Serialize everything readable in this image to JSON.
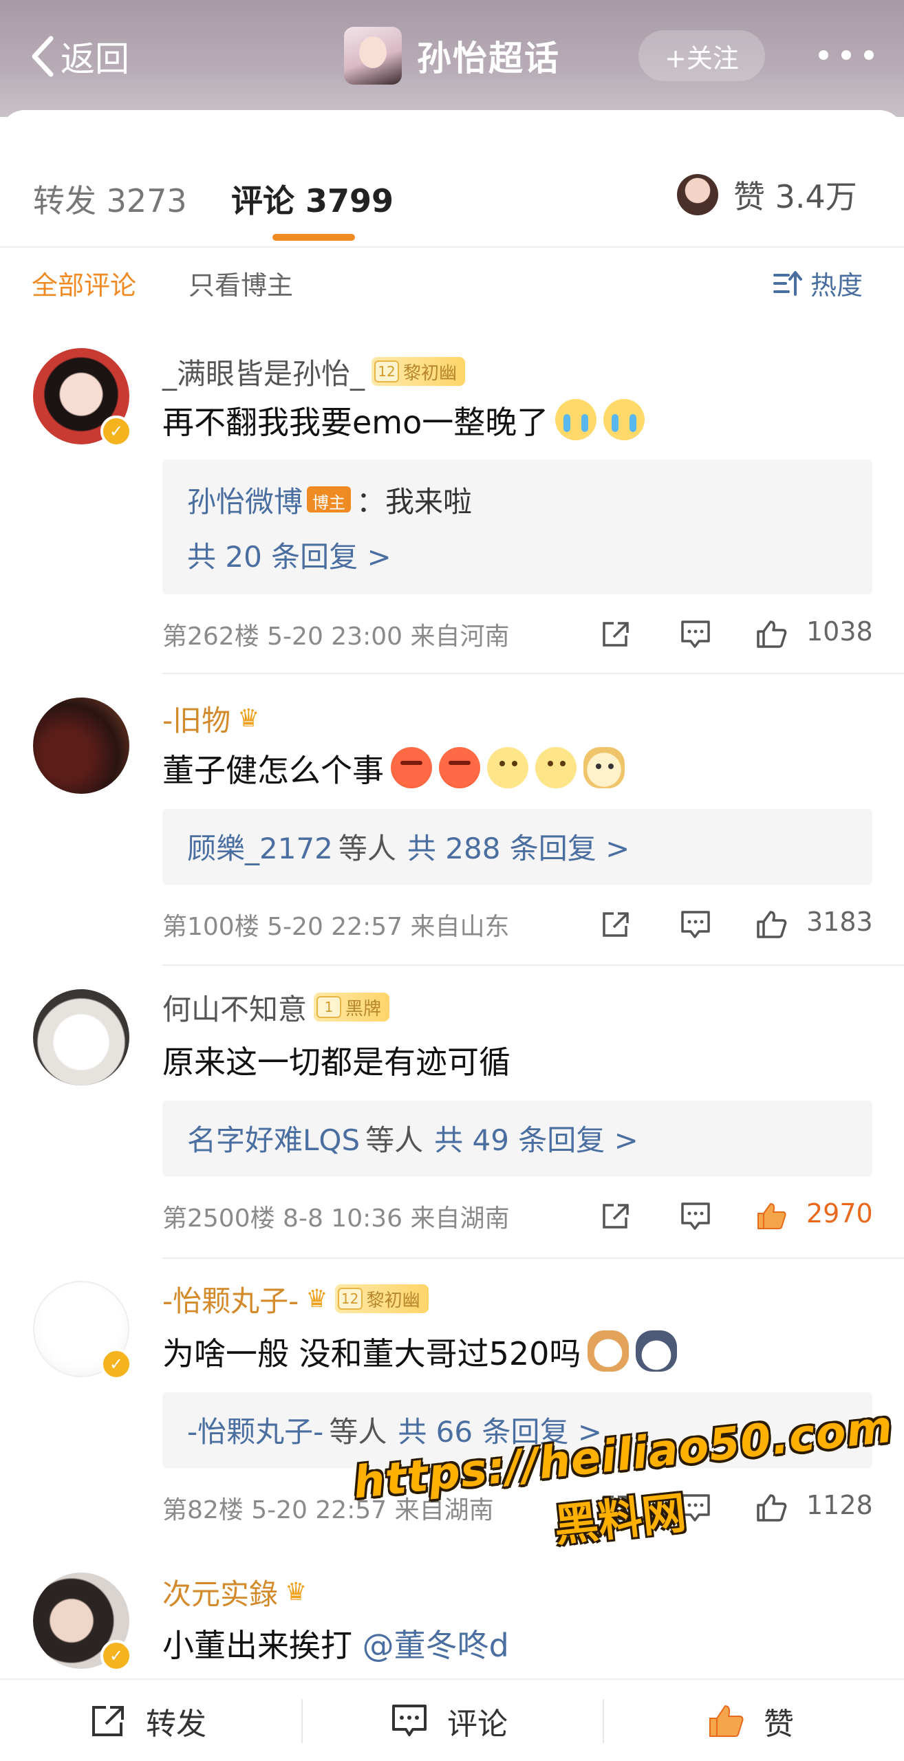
{
  "header": {
    "back_label": "返回",
    "title": "孙怡超话",
    "follow_label": "+关注"
  },
  "tabs": {
    "repost": "转发 3273",
    "comment": "评论 3799",
    "like": "赞 3.4万"
  },
  "filter": {
    "all": "全部评论",
    "owner_only": "只看博主",
    "sort": "热度"
  },
  "comments": [
    {
      "username": "_满眼皆是孙怡_",
      "badge_level": "12",
      "badge_text": "黎初幽",
      "text": "再不翻我我要emo一整晚了",
      "reply_user": "孙怡微博",
      "owner_tag": "博主",
      "reply_text": "：我来啦",
      "reply_total": "共 20 条回复 >",
      "meta": "第262楼 5-20 23:00 来自河南",
      "likes": "1038"
    },
    {
      "username": "-旧物",
      "text": "董子健怎么个事",
      "reply_user": "顾樂_2172",
      "reply_muted": "等人",
      "reply_total": "共 288 条回复 >",
      "meta": "第100楼 5-20 22:57 来自山东",
      "likes": "3183"
    },
    {
      "username": "何山不知意",
      "badge_level": "1",
      "badge_text": "黑牌",
      "text": "原来这一切都是有迹可循",
      "reply_user": "名字好难LQS",
      "reply_muted": "等人",
      "reply_total": "共 49 条回复 >",
      "meta": "第2500楼 8-8 10:36 来自湖南",
      "likes": "2970"
    },
    {
      "username": "-怡颗丸子-",
      "badge_level": "12",
      "badge_text": "黎初幽",
      "text": "为啥一般 没和董大哥过520吗",
      "reply_user": "-怡颗丸子-",
      "reply_muted": "等人",
      "reply_total": "共 66 条回复 >",
      "meta": "第82楼 5-20 22:57 来自湖南",
      "likes": "1128"
    },
    {
      "username": "次元实錄",
      "text": "小董出来挨打",
      "mention": "@董冬咚d"
    }
  ],
  "watermark": {
    "url": "https://heiliao50.com",
    "name": "黑料网"
  },
  "bottom": {
    "repost": "转发",
    "comment": "评论",
    "like": "赞"
  },
  "colors": {
    "accent": "#f08a23",
    "link": "#4a6ea0",
    "like_active": "#e8681c"
  }
}
